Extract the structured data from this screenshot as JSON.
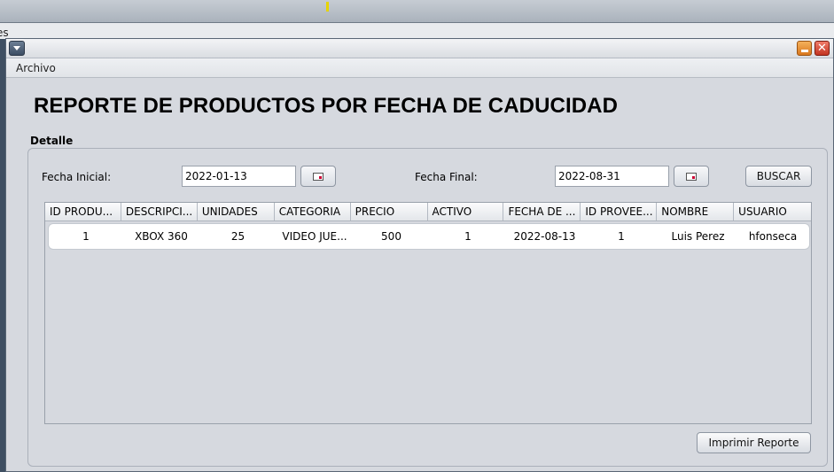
{
  "background": {
    "partial_label": "es"
  },
  "window": {
    "title": ""
  },
  "menu": {
    "items": [
      "Archivo"
    ]
  },
  "page": {
    "title": "REPORTE DE PRODUCTOS POR FECHA DE CADUCIDAD"
  },
  "group": {
    "label": "Detalle"
  },
  "filters": {
    "start_label": "Fecha Inicial:",
    "start_value": "2022-01-13",
    "end_label": "Fecha Final:",
    "end_value": "2022-08-31",
    "search_button": "BUSCAR"
  },
  "table": {
    "columns": [
      "ID PRODU...",
      "DESCRIPCI...",
      "UNIDADES",
      "CATEGORIA",
      "PRECIO",
      "ACTIVO",
      "FECHA DE ...",
      "ID PROVEE...",
      "NOMBRE",
      "USUARIO"
    ],
    "rows": [
      [
        "1",
        "XBOX 360",
        "25",
        "VIDEO JUE...",
        "500",
        "1",
        "2022-08-13",
        "1",
        "Luis Perez",
        "hfonseca"
      ]
    ]
  },
  "actions": {
    "print_button": "Imprimir Reporte"
  },
  "colors": {
    "frame_bg": "#d6d9df",
    "minimize": "#e58a2c",
    "close": "#d9452f"
  },
  "icons": [
    "system-menu-icon",
    "minimize-icon",
    "close-icon",
    "calendar-icon"
  ]
}
